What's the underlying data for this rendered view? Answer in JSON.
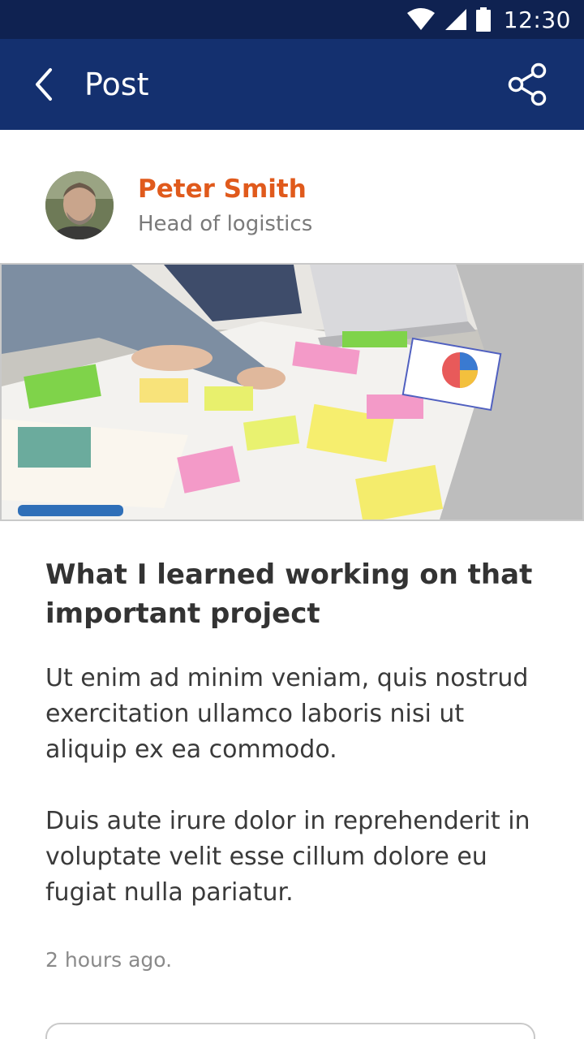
{
  "status_bar": {
    "time": "12:30",
    "icons": [
      "wifi-icon",
      "signal-icon",
      "battery-icon"
    ]
  },
  "app_bar": {
    "title": "Post",
    "back_icon": "chevron-left-icon",
    "share_icon": "share-icon"
  },
  "author": {
    "name": "Peter Smith",
    "role": "Head of logistics"
  },
  "post": {
    "title": "What I learned working on that important project",
    "paragraphs": [
      "Ut enim ad minim veniam, quis nostrud exercitation ullamco laboris nisi ut aliquip ex ea commodo.",
      "Duis aute irure dolor in reprehenderit in voluptate velit esse cillum dolore eu fugiat nulla pariatur."
    ],
    "timestamp": "2 hours ago."
  },
  "colors": {
    "status_bar": "#0f2251",
    "app_bar": "#14306f",
    "author_name": "#e05a1c",
    "body_text": "#3a3a3a",
    "muted_text": "#8a8a8a"
  }
}
